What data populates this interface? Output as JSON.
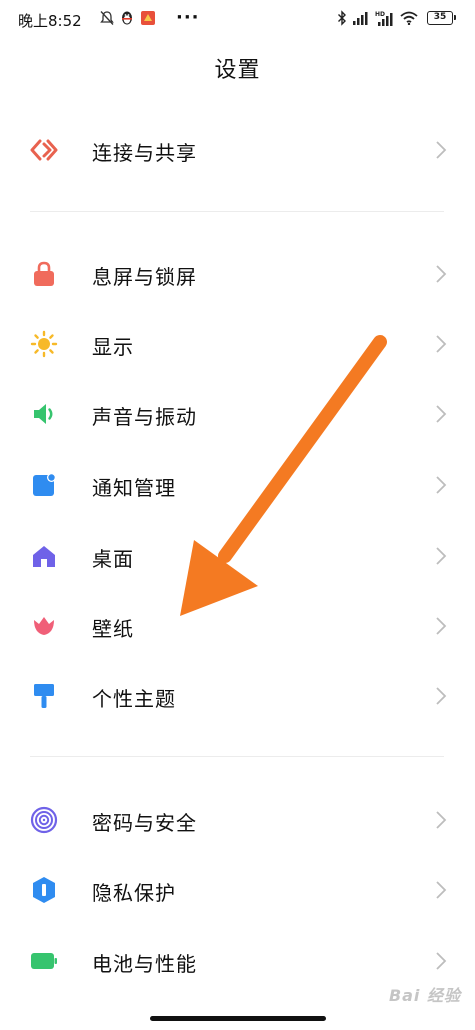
{
  "status_bar": {
    "time": "晚上8:52",
    "more": "···",
    "battery": "35"
  },
  "title": "设置",
  "settings": {
    "connection": "连接与共享",
    "lock_screen": "息屏与锁屏",
    "display": "显示",
    "sound": "声音与振动",
    "notifications": "通知管理",
    "desktop": "桌面",
    "wallpaper": "壁纸",
    "themes": "个性主题",
    "password": "密码与安全",
    "privacy": "隐私保护",
    "battery": "电池与性能"
  },
  "icons": {
    "connection": "connection-share-icon",
    "lock_screen": "lock-icon",
    "display": "sun-icon",
    "sound": "speaker-icon",
    "notifications": "notification-icon",
    "desktop": "home-icon",
    "wallpaper": "tulip-icon",
    "themes": "paintbrush-icon",
    "password": "fingerprint-icon",
    "privacy": "privacy-shield-icon",
    "battery": "battery-icon"
  },
  "colors": {
    "connection": "#e8624f",
    "lock_screen": "#f06b5c",
    "display": "#f7b928",
    "sound": "#36c46e",
    "notifications": "#2f8cf0",
    "desktop": "#6f62e8",
    "wallpaper": "#f05f78",
    "themes": "#2f8cf0",
    "password": "#6f62e8",
    "privacy": "#2f8cf0",
    "battery": "#36c46e",
    "annotation_arrow": "#f47a22"
  },
  "watermark": "Bai 经验"
}
